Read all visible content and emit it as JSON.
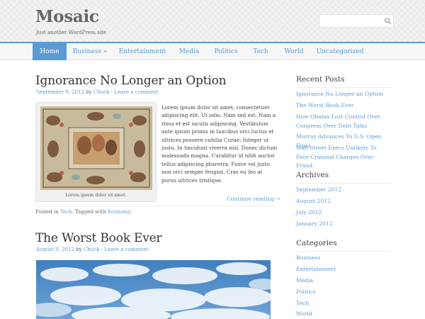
{
  "site": {
    "title": "Mosaic",
    "tagline": "Just another WordPress site"
  },
  "search": {
    "placeholder": "",
    "icon": "search-icon"
  },
  "nav": {
    "items": [
      "Home",
      "Business »",
      "Entertainment",
      "Media",
      "Politics",
      "Tech",
      "World",
      "Uncategorized"
    ],
    "active": "Home"
  },
  "posts": [
    {
      "title": "Ignorance No Longer an Option",
      "date": "September 9, 2012",
      "by": "by",
      "author": "Chuck",
      "separator": "·",
      "comment_link": "Leave a comment",
      "image_caption": "Lorem ipsum dolor sit amet.",
      "excerpt": "Lorem ipsum dolor sit amet, consectetuer adipiscing elit. Ut odio. Nam sed est. Nam a risus et est iaculis adipiscing. Vestibulum ante ipsum primis in faucibus orci luctus et ultrices posuere cubilia Curae; Integer ut justo. In tincidunt viverra nisl. Donec dictum malesuada magna. Curabitur id nibh auctor tellus adipiscing pharetra. Fusce vel justo non orci semper feugiat. Cras eu leo at purus ultrices tristique.",
      "continue_link": "Continue reading →",
      "posted_in_label": "Posted in",
      "category": "Tech",
      "tagged_label": ". Tagged with",
      "tag": "Economy",
      "tag_end": "."
    },
    {
      "title": "The Worst Book Ever",
      "date": "August 9, 2012",
      "by": "by",
      "author": "Chuck",
      "separator": "·",
      "comment_link": "Leave a comment"
    }
  ],
  "sidebar": {
    "recent_posts": {
      "heading": "Recent Posts",
      "items": [
        "Ignorance No Longer an Option",
        "The Worst Book Ever",
        "How Obama Lost Control Over Congress Over Debt Talks",
        "Murray Advances To U.S. Open Final",
        "Wall Street Execs Unlikely To Face Criminal Charges Over Fraud"
      ]
    },
    "archives": {
      "heading": "Archives",
      "items": [
        "September 2012",
        "August 2012",
        "July 2012",
        "January 2012"
      ]
    },
    "categories": {
      "heading": "Categories",
      "items": [
        "Business",
        "Entertainment",
        "Media",
        "Politics",
        "Tech",
        "World"
      ]
    }
  },
  "colors": {
    "accent": "#5b9bd5",
    "header_bg": "#f3f3f3",
    "text": "#444444"
  }
}
